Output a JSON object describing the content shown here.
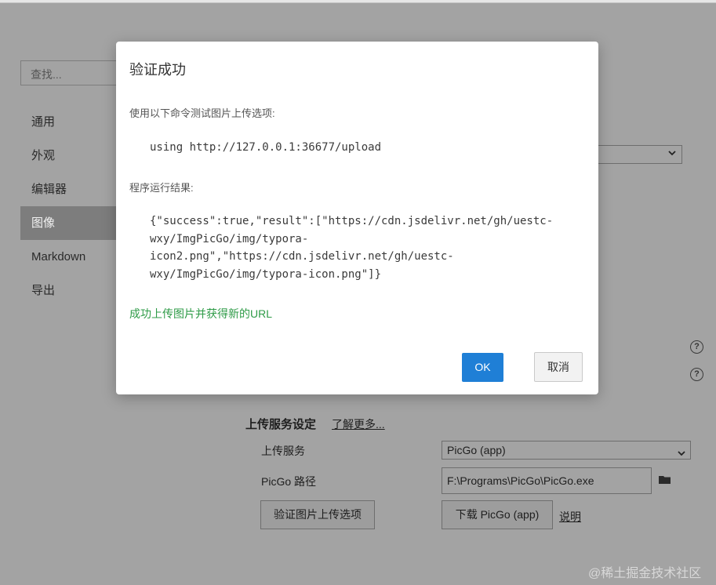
{
  "sidebar": {
    "search_placeholder": "查找...",
    "items": [
      {
        "label": "通用",
        "active": false
      },
      {
        "label": "外观",
        "active": false
      },
      {
        "label": "编辑器",
        "active": false
      },
      {
        "label": "图像",
        "active": true
      },
      {
        "label": "Markdown",
        "active": false
      },
      {
        "label": "导出",
        "active": false
      }
    ]
  },
  "upload_settings": {
    "title": "上传服务设定",
    "learn_more": "了解更多...",
    "service_label": "上传服务",
    "service_value": "PicGo (app)",
    "path_label": "PicGo 路径",
    "path_value": "F:\\Programs\\PicGo\\PicGo.exe",
    "verify_button": "验证图片上传选项",
    "download_button": "下载 PicGo (app)",
    "help_link": "说明"
  },
  "dialog": {
    "title": "验证成功",
    "instruction": "使用以下命令测试图片上传选项:",
    "command": "using http://127.0.0.1:36677/upload",
    "result_label": "程序运行结果:",
    "result_lines": [
      "{\"success\":true,\"result\":[\"https://cdn.jsdelivr.net/gh/uestc-",
      "wxy/ImgPicGo/img/typora-",
      "icon2.png\",\"https://cdn.jsdelivr.net/gh/uestc-",
      "wxy/ImgPicGo/img/typora-icon.png\"]}"
    ],
    "success_message": "成功上传图片并获得新的URL",
    "ok_label": "OK",
    "cancel_label": "取消"
  },
  "watermark": "@稀土掘金技术社区",
  "colors": {
    "overlay_bg": "#a3a3a3",
    "primary_button": "#1f7fd6",
    "success_text": "#2e9b47"
  }
}
